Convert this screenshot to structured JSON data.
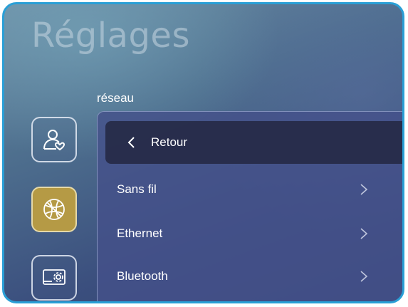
{
  "page": {
    "title": "Réglages",
    "section": "réseau"
  },
  "sidebar": {
    "items": [
      {
        "icon": "user-settings-icon",
        "active": false
      },
      {
        "icon": "globe-network-icon",
        "active": true
      },
      {
        "icon": "display-gear-icon",
        "active": false
      }
    ]
  },
  "menu": {
    "back_label": "Retour",
    "items": [
      {
        "label": "Sans fil"
      },
      {
        "label": "Ethernet"
      },
      {
        "label": "Bluetooth"
      }
    ]
  },
  "colors": {
    "frame": "#2a9fd6",
    "active_tab": "#b59a45",
    "panel": "#44508a",
    "back_row": "#262a46"
  }
}
